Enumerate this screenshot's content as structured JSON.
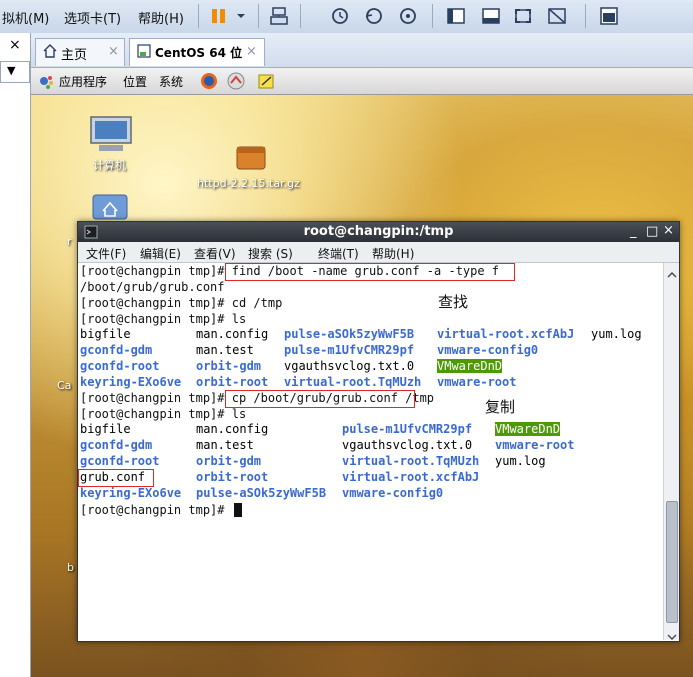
{
  "app_menu": {
    "item_vm": "拟机(M)",
    "item_tabs": "选项卡(T)",
    "item_help": "帮助(H)"
  },
  "left_pane": {
    "close_glyph": "×",
    "dropdown_glyph": "▼"
  },
  "tabs": [
    {
      "label": "主页",
      "close": "×"
    },
    {
      "label": "CentOS 64 位",
      "close": "×"
    }
  ],
  "gnome_panel": {
    "applications": "应用程序",
    "places": "位置",
    "system": "系统"
  },
  "desktop": {
    "icons": [
      {
        "label": "计算机",
        "icon": "computer-icon"
      },
      {
        "label": "httpd-2.2.15.tar.gz",
        "icon": "archive-icon"
      }
    ],
    "partial_labels": [
      "r",
      "Ca",
      "b"
    ]
  },
  "terminal": {
    "title": "root@changpin:/tmp",
    "window_controls": {
      "minimize": "_",
      "maximize": "□",
      "close": "×"
    },
    "menu": [
      "文件(F)",
      "编辑(E)",
      "查看(V)",
      "搜索 (S)",
      "终端(T)",
      "帮助(H)"
    ],
    "lines": [
      {
        "prompt": "[root@changpin tmp]#",
        "cmd": " find /boot -name grub.conf -a -type f"
      },
      {
        "text": "/boot/grub/grub.conf"
      },
      {
        "prompt": "[root@changpin tmp]#",
        "cmd": " cd /tmp"
      },
      {
        "prompt": "[root@changpin tmp]#",
        "cmd": " ls"
      },
      {
        "prompt": "[root@changpin tmp]#",
        "cmd": " cp /boot/grub/grub.conf /tmp"
      },
      {
        "prompt": "[root@changpin tmp]#",
        "cmd": " ls"
      },
      {
        "prompt": "[root@changpin tmp]#",
        "cmd": " "
      }
    ],
    "ls1": [
      [
        "bigfile",
        "man.config",
        "pulse-aSOk5zyWwF5B",
        "virtual-root.xcfAbJ",
        "yum.log"
      ],
      [
        "gconfd-gdm",
        "man.test",
        "pulse-m1UfvCMR29pf",
        "vmware-config0"
      ],
      [
        "gconfd-root",
        "orbit-gdm",
        "vgauthsvclog.txt.0",
        "VMwareDnD"
      ],
      [
        "keyring-EXo6ve",
        "orbit-root",
        "virtual-root.TqMUzh",
        "vmware-root"
      ]
    ],
    "ls2": [
      [
        "bigfile",
        "man.config",
        "pulse-m1UfvCMR29pf",
        "VMwareDnD"
      ],
      [
        "gconfd-gdm",
        "man.test",
        "vgauthsvclog.txt.0",
        "vmware-root"
      ],
      [
        "gconfd-root",
        "orbit-gdm",
        "virtual-root.TqMUzh",
        "yum.log"
      ],
      [
        "grub.conf",
        "orbit-root",
        "virtual-root.xcfAbJ"
      ],
      [
        "keyring-EXo6ve",
        "pulse-aSOk5zyWwF5B",
        "vmware-config0"
      ]
    ],
    "annotations": {
      "find": "查找",
      "copy": "复制"
    }
  },
  "colors": {
    "dir_blue": "#3a6ad1",
    "highlight_green": "#4e9a06",
    "annotation_red": "#e0282a"
  }
}
